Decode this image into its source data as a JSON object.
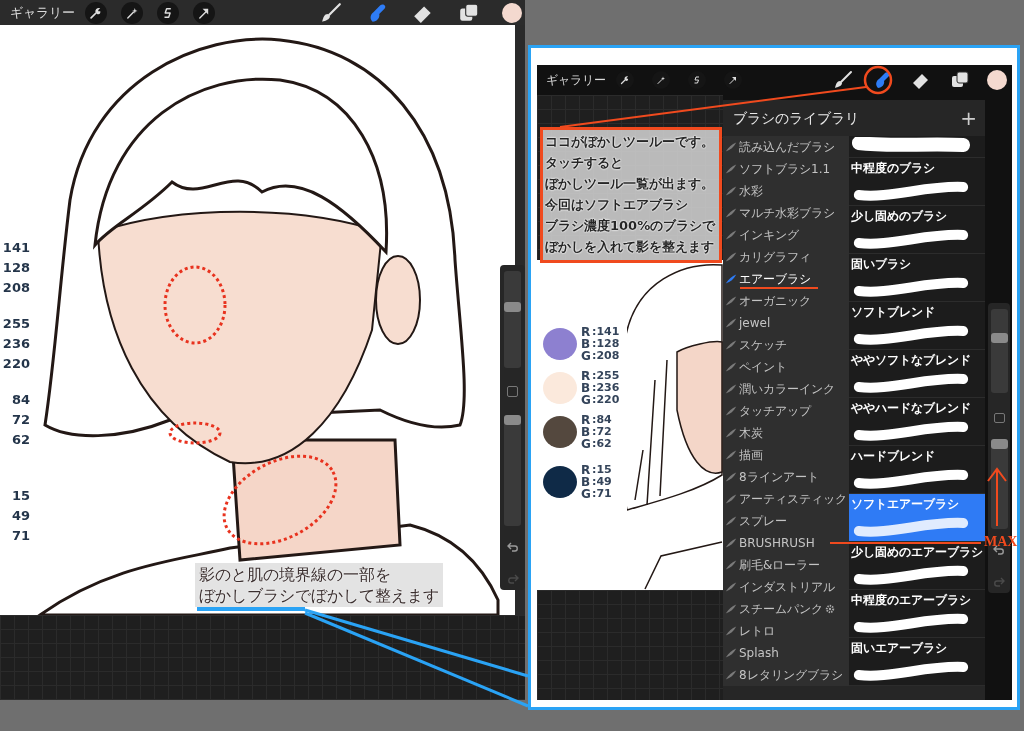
{
  "left_screen": {
    "toolbar": {
      "gallery": "ギャラリー",
      "color": "#f4d9cf",
      "tools": [
        {
          "kind": "brush",
          "selected": false
        },
        {
          "kind": "smudge",
          "selected": true
        },
        {
          "kind": "eraser",
          "selected": false
        },
        {
          "kind": "layers",
          "selected": false
        }
      ]
    },
    "color_values": [
      {
        "values": [
          "141",
          "128",
          "208"
        ]
      },
      {
        "values": [
          "255",
          "236",
          "220"
        ]
      },
      {
        "values": [
          "84",
          "72",
          "62"
        ]
      },
      {
        "values": [
          "15",
          "49",
          "71"
        ]
      }
    ],
    "caption": [
      "影のと肌の境界線の一部を",
      "ぼかしブラシでぼかして整えます"
    ],
    "sliders": [
      {
        "level": 0.64
      },
      {
        "level": 0.95
      }
    ]
  },
  "right_screen": {
    "toolbar": {
      "gallery": "ギャラリー",
      "color": "#f4d9cf",
      "tools": [
        {
          "kind": "brush",
          "selected": false
        },
        {
          "kind": "smudge",
          "selected": true
        },
        {
          "kind": "eraser",
          "selected": false
        },
        {
          "kind": "layers",
          "selected": false
        }
      ]
    },
    "swatches": [
      {
        "color": "#8d80d0",
        "rows": [
          {
            "channel": "R",
            "value": ":141"
          },
          {
            "channel": "B",
            "value": ":128"
          },
          {
            "channel": "G",
            "value": ":208"
          }
        ]
      },
      {
        "color": "#fbe9dc",
        "rows": [
          {
            "channel": "R",
            "value": ":255"
          },
          {
            "channel": "B",
            "value": ":236"
          },
          {
            "channel": "G",
            "value": ":220"
          }
        ]
      },
      {
        "color": "#54483e",
        "rows": [
          {
            "channel": "R",
            "value": ":84"
          },
          {
            "channel": "B",
            "value": ":72"
          },
          {
            "channel": "G",
            "value": ":62"
          }
        ]
      },
      {
        "color": "#0f2a47",
        "rows": [
          {
            "channel": "R",
            "value": ":15"
          },
          {
            "channel": "B",
            "value": ":49"
          },
          {
            "channel": "G",
            "value": ":71"
          }
        ]
      }
    ],
    "brush_library": {
      "title": "ブラシのライブラリ",
      "add": "+",
      "categories": [
        {
          "name": "読み込んだブラシ",
          "selected": false,
          "gear": false
        },
        {
          "name": "ソフトブラシ1.1",
          "selected": false,
          "gear": false
        },
        {
          "name": "水彩",
          "selected": false,
          "gear": false
        },
        {
          "name": "マルチ水彩ブラシ",
          "selected": false,
          "gear": false
        },
        {
          "name": "インキング",
          "selected": false,
          "gear": false
        },
        {
          "name": "カリグラフィ",
          "selected": false,
          "gear": false
        },
        {
          "name": "エアーブラシ",
          "selected": true,
          "gear": false
        },
        {
          "name": "オーガニック",
          "selected": false,
          "gear": false
        },
        {
          "name": "jewel",
          "selected": false,
          "gear": false
        },
        {
          "name": "スケッチ",
          "selected": false,
          "gear": false
        },
        {
          "name": "ペイント",
          "selected": false,
          "gear": false
        },
        {
          "name": "潤いカラーインク",
          "selected": false,
          "gear": false
        },
        {
          "name": "タッチアップ",
          "selected": false,
          "gear": false
        },
        {
          "name": "木炭",
          "selected": false,
          "gear": false
        },
        {
          "name": "描画",
          "selected": false,
          "gear": false
        },
        {
          "name": "8ラインアート",
          "selected": false,
          "gear": false
        },
        {
          "name": "アーティスティック",
          "selected": false,
          "gear": false
        },
        {
          "name": "スプレー",
          "selected": false,
          "gear": false
        },
        {
          "name": "BRUSHRUSH",
          "selected": false,
          "gear": false
        },
        {
          "name": "刷毛&ローラー",
          "selected": false,
          "gear": false
        },
        {
          "name": "インダストリアル",
          "selected": false,
          "gear": false
        },
        {
          "name": "スチームパンク",
          "selected": false,
          "gear": true
        },
        {
          "name": "レトロ",
          "selected": false,
          "gear": false
        },
        {
          "name": "Splash",
          "selected": false,
          "gear": false
        },
        {
          "name": "8レタリングブラシ",
          "selected": false,
          "gear": false
        }
      ],
      "brushes": [
        {
          "selected": false
        },
        {
          "name": "中程度のブラシ",
          "selected": false
        },
        {
          "name": "少し固めのブラシ",
          "selected": false
        },
        {
          "name": "固いブラシ",
          "selected": false
        },
        {
          "name": "ソフトブレンド",
          "selected": false
        },
        {
          "name": "ややソフトなブレンド",
          "selected": false
        },
        {
          "name": "ややハードなブレンド",
          "selected": false
        },
        {
          "name": "ハードブレンド",
          "selected": false
        },
        {
          "name": "ソフトエアーブラシ",
          "selected": true
        },
        {
          "name": "少し固めのエアーブラシ",
          "selected": false
        },
        {
          "name": "中程度のエアーブラシ",
          "selected": false
        },
        {
          "name": "固いエアーブラシ",
          "selected": false
        }
      ]
    },
    "sliders": [
      {
        "level": 0.7
      },
      {
        "level": 0.95
      }
    ],
    "callout": [
      "ココがぼかしツールーです。",
      "タッチすると",
      "ぼかしツール一覧が出ます。",
      "今回はソフトエアブラシ",
      "ブラシ濃度100%のブラシで",
      "ぼかしを入れて影を整えます"
    ]
  },
  "max_label": "MAX"
}
